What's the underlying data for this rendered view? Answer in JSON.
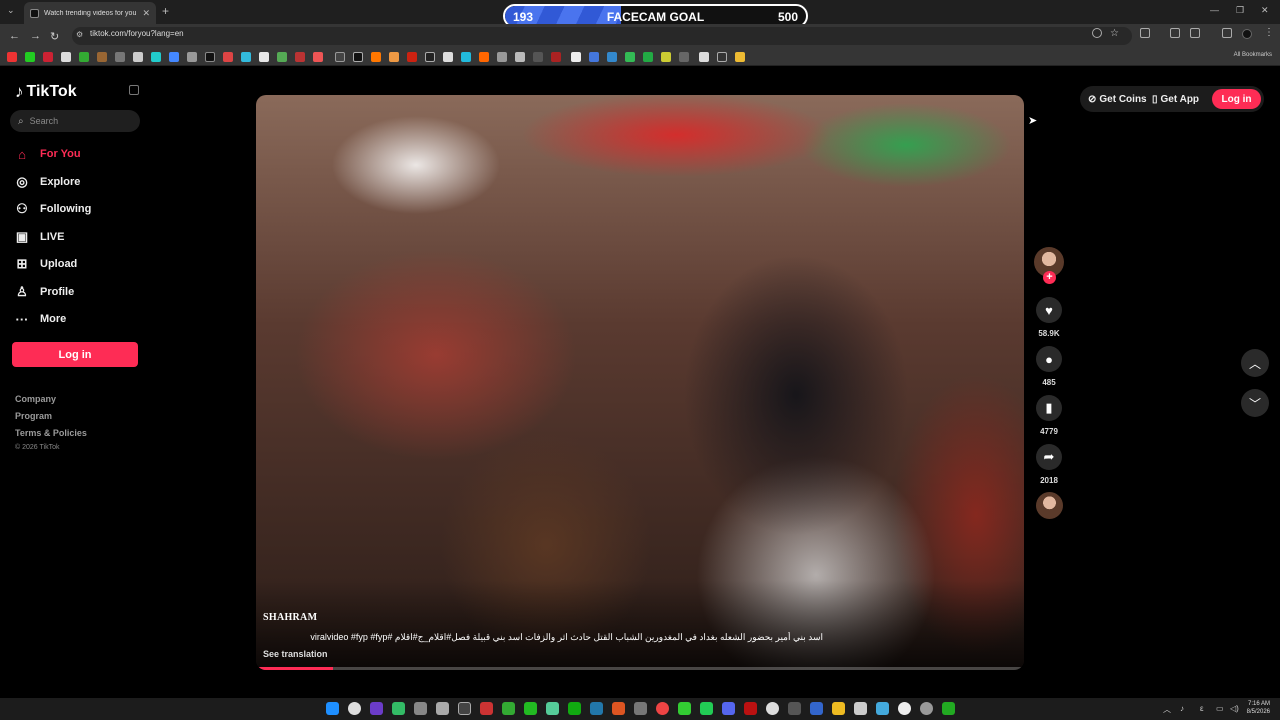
{
  "browser": {
    "tab_title": "Watch trending videos for you | TikTok",
    "url": "tiktok.com/foryou?lang=en",
    "all_bookmarks": "All Bookmarks"
  },
  "facecam_goal": {
    "current": "193",
    "label": "FACECAM GOAL",
    "target": "500",
    "progress_fraction": 0.386
  },
  "sidebar": {
    "logo": "TikTok",
    "search_placeholder": "Search",
    "nav": [
      {
        "label": "For You",
        "icon": "home-icon",
        "active": true
      },
      {
        "label": "Explore",
        "icon": "compass-icon"
      },
      {
        "label": "Following",
        "icon": "user-icon"
      },
      {
        "label": "LIVE",
        "icon": "live-icon"
      },
      {
        "label": "Upload",
        "icon": "plus-square-icon"
      },
      {
        "label": "Profile",
        "icon": "profile-icon"
      },
      {
        "label": "More",
        "icon": "more-icon"
      }
    ],
    "login": "Log in",
    "footer": [
      "Company",
      "Program",
      "Terms & Policies"
    ],
    "copyright": "© 2026 TikTok"
  },
  "video": {
    "author": "SHAHRAM",
    "caption": "اسد بني أمير بحضور الشعله بغداد في المغدورين الشباب القتل حادث اثر والزفات اسد بني قبيلة فصل#اقلام_ج#اقلام #viralvideo #fyp #fyp",
    "see_translation": "See translation",
    "progress_fraction": 0.1
  },
  "actions": {
    "likes": "58.9K",
    "comments": "485",
    "saves": "4779",
    "shares": "2018"
  },
  "topbar": {
    "get_coins": "Get Coins",
    "get_app": "Get App",
    "login": "Log in"
  },
  "system": {
    "time": "7:16 AM",
    "date": "8/5/2026"
  },
  "colors": {
    "brand": "#fe2c55",
    "goal_fill": "#3f68e6"
  }
}
